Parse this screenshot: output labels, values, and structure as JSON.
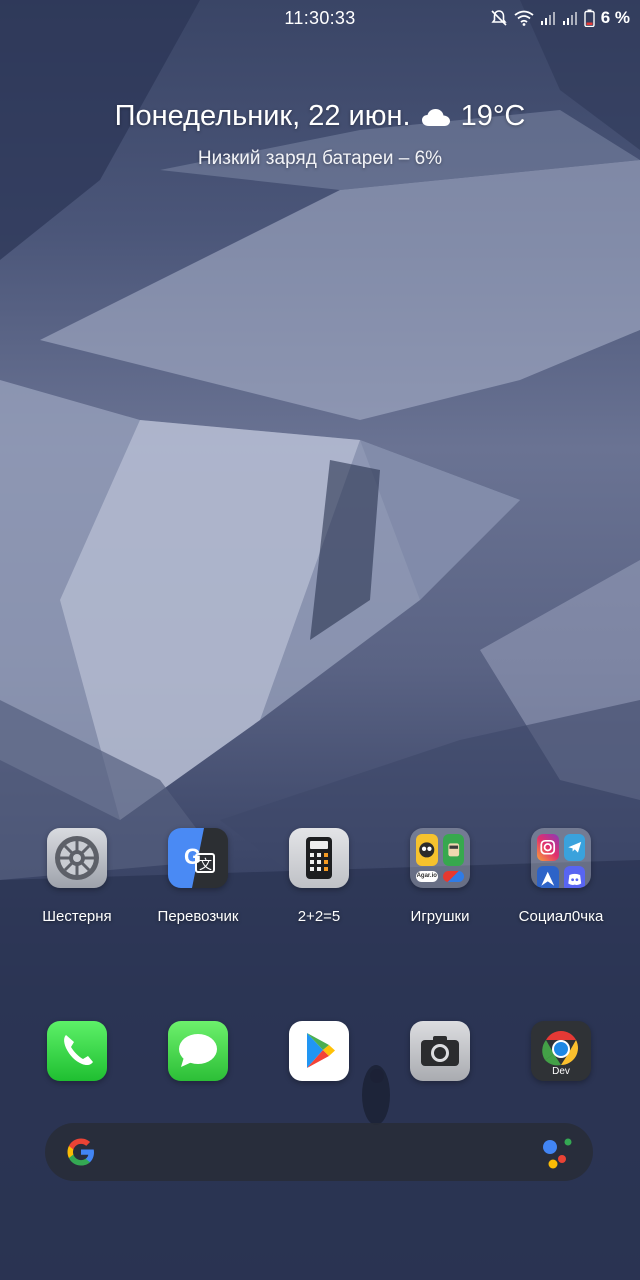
{
  "status_bar": {
    "time": "11:30:33",
    "battery_percent": "6 %"
  },
  "widget": {
    "date": "Понедельник, 22 июн.",
    "temperature": "19°C",
    "weather_icon": "cloud-icon",
    "battery_message": "Низкий заряд батареи – 6%"
  },
  "apps": [
    {
      "label": "Шестерня",
      "icon": "settings-gear-icon"
    },
    {
      "label": "Перевозчик",
      "icon": "translate-icon"
    },
    {
      "label": "2+2=5",
      "icon": "calculator-icon"
    },
    {
      "label": "Игрушки",
      "icon": "folder-icon"
    },
    {
      "label": "Социал0чка",
      "icon": "folder-icon"
    }
  ],
  "folder_games": {
    "items": [
      "brawl-stars-icon",
      "game-icon",
      "agar-io-icon",
      "game-icon"
    ],
    "agar_label": "Agar.io"
  },
  "folder_social": {
    "items": [
      "instagram-icon",
      "telegram-icon",
      "arrow-icon",
      "discord-icon"
    ]
  },
  "dock": [
    {
      "icon": "phone-icon"
    },
    {
      "icon": "messages-icon"
    },
    {
      "icon": "play-store-icon"
    },
    {
      "icon": "camera-icon"
    },
    {
      "icon": "chrome-dev-icon",
      "badge": "Dev"
    }
  ],
  "search": {
    "logo": "google-g-icon",
    "assistant": "google-assistant-icon"
  },
  "colors": {
    "phone": "#28c840",
    "messages": "#35c53d",
    "battery_low": "#e53935"
  }
}
